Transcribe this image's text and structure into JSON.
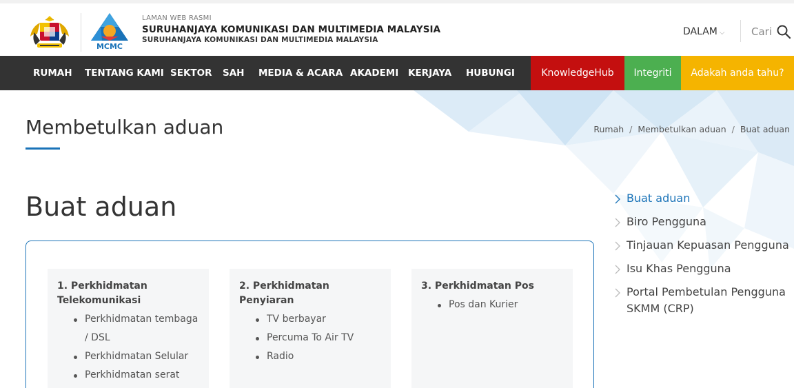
{
  "header": {
    "label_small": "LAMAN WEB RASMI",
    "org_name": "SURUHANJAYA KOMUNIKASI DAN MULTIMEDIA MALAYSIA",
    "org_name_sub": "SURUHANJAYA KOMUNIKASI DAN MULTIMEDIA MALAYSIA",
    "logo_text": "MCMC",
    "language": "DALAM",
    "search_label": "Cari"
  },
  "nav": {
    "items": [
      "RUMAH",
      "TENTANG KAMI",
      "SEKTOR",
      "SAH",
      "MEDIA & ACARA",
      "AKADEMI",
      "KERJAYA",
      "HUBUNGI"
    ],
    "blocks": [
      {
        "label": "KnowledgeHub",
        "color": "#c40f0f"
      },
      {
        "label": "Integriti",
        "color": "#4caf50"
      },
      {
        "label": "Adakah anda tahu?",
        "color": "#f5b400"
      }
    ]
  },
  "page": {
    "title": "Membetulkan aduan",
    "breadcrumb": [
      "Rumah",
      "Membetulkan aduan",
      "Buat aduan"
    ],
    "section_title": "Buat aduan"
  },
  "services": [
    {
      "title": "1. Perkhidmatan Telekomunikasi",
      "items": [
        "Perkhidmatan tembaga / DSL",
        "Perkhidmatan Selular",
        "Perkhidmatan serat"
      ]
    },
    {
      "title": "2. Perkhidmatan Penyiaran",
      "items": [
        "TV berbayar",
        "Percuma To Air TV",
        "Radio"
      ]
    },
    {
      "title": "3. Perkhidmatan Pos",
      "items": [
        "Pos dan Kurier"
      ]
    }
  ],
  "side_nav": [
    {
      "label": "Buat aduan",
      "active": true
    },
    {
      "label": "Biro Pengguna",
      "active": false
    },
    {
      "label": "Tinjauan Kepuasan Pengguna",
      "active": false
    },
    {
      "label": "Isu Khas Pengguna",
      "active": false
    },
    {
      "label": "Portal Pembetulan Pengguna SKMM (CRP)",
      "active": false
    }
  ],
  "colors": {
    "accent": "#1a73b8",
    "nav_bg": "#333333"
  }
}
